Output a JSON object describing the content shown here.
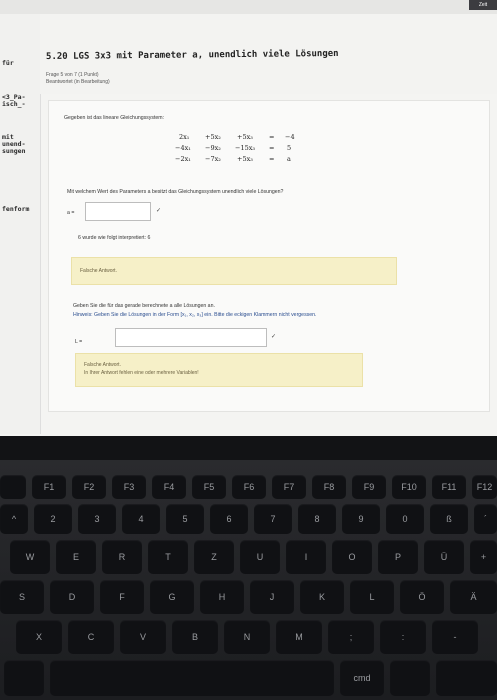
{
  "topbar": {
    "accent": "Zeit"
  },
  "sidebar": {
    "items": [
      {
        "label": "für"
      },
      {
        "label": "<3_Pa-\nisch_-"
      },
      {
        "label": "mit\nunend-\nsungen"
      },
      {
        "label": "fenform"
      }
    ]
  },
  "question": {
    "title": "5.20 LGS 3x3 mit Parameter a, unendlich viele Lösungen",
    "meta1": "Frage 5 von 7 (1 Punkt)",
    "meta2": "Beantwortet (in Bearbeitung)"
  },
  "content": {
    "intro": "Gegeben ist das lineare Gleichungssystem:",
    "equations": [
      [
        "2x₁",
        "+5x₂",
        "+5x₃",
        "=",
        "−4"
      ],
      [
        "−4x₁",
        "−9x₂",
        "−15x₃",
        "=",
        "5"
      ],
      [
        "−2x₁",
        "−7x₂",
        "+5x₃",
        "=",
        "a"
      ]
    ],
    "q1": "Mit welchem Wert des Parameters a besitzt das Gleichungssystem unendlich viele Lösungen?",
    "a_label": "a =",
    "a_value": "",
    "check": "✓",
    "interp": "6 wurde wie folgt interpretiert: 6",
    "fb1": "Falsche Antwort.",
    "q2": "Geben Sie die für das gerade berechnete a alle Lösungen an.",
    "hint": "Hinweis: Geben Sie die Lösungen in der Form [x₁, x₂, x₃] ein. Bitte die eckigen Klammern nicht vergessen.",
    "l_label": "L =",
    "l_value": "",
    "fb2a": "Falsche Antwort.",
    "fb2b": "In Ihrer Antwort fehlen eine oder mehrere Variablen!"
  },
  "keyboard": {
    "fn_row": [
      "",
      "F1",
      "F2",
      "F3",
      "F4",
      "F5",
      "F6",
      "F7",
      "F8",
      "F9",
      "F10",
      "F11",
      "F12"
    ],
    "num_row": [
      "^",
      "2",
      "3",
      "4",
      "5",
      "6",
      "7",
      "8",
      "9",
      "0",
      "ß",
      "´"
    ],
    "top_row": [
      "W",
      "E",
      "R",
      "T",
      "Z",
      "U",
      "I",
      "O",
      "P",
      "Ü",
      "+"
    ],
    "home_row": [
      "S",
      "D",
      "F",
      "G",
      "H",
      "J",
      "K",
      "L",
      "Ö",
      "Ä"
    ],
    "bottom_row": [
      "X",
      "C",
      "V",
      "B",
      "N",
      "M",
      ";",
      ":",
      "-"
    ],
    "cmd": "cmd"
  }
}
